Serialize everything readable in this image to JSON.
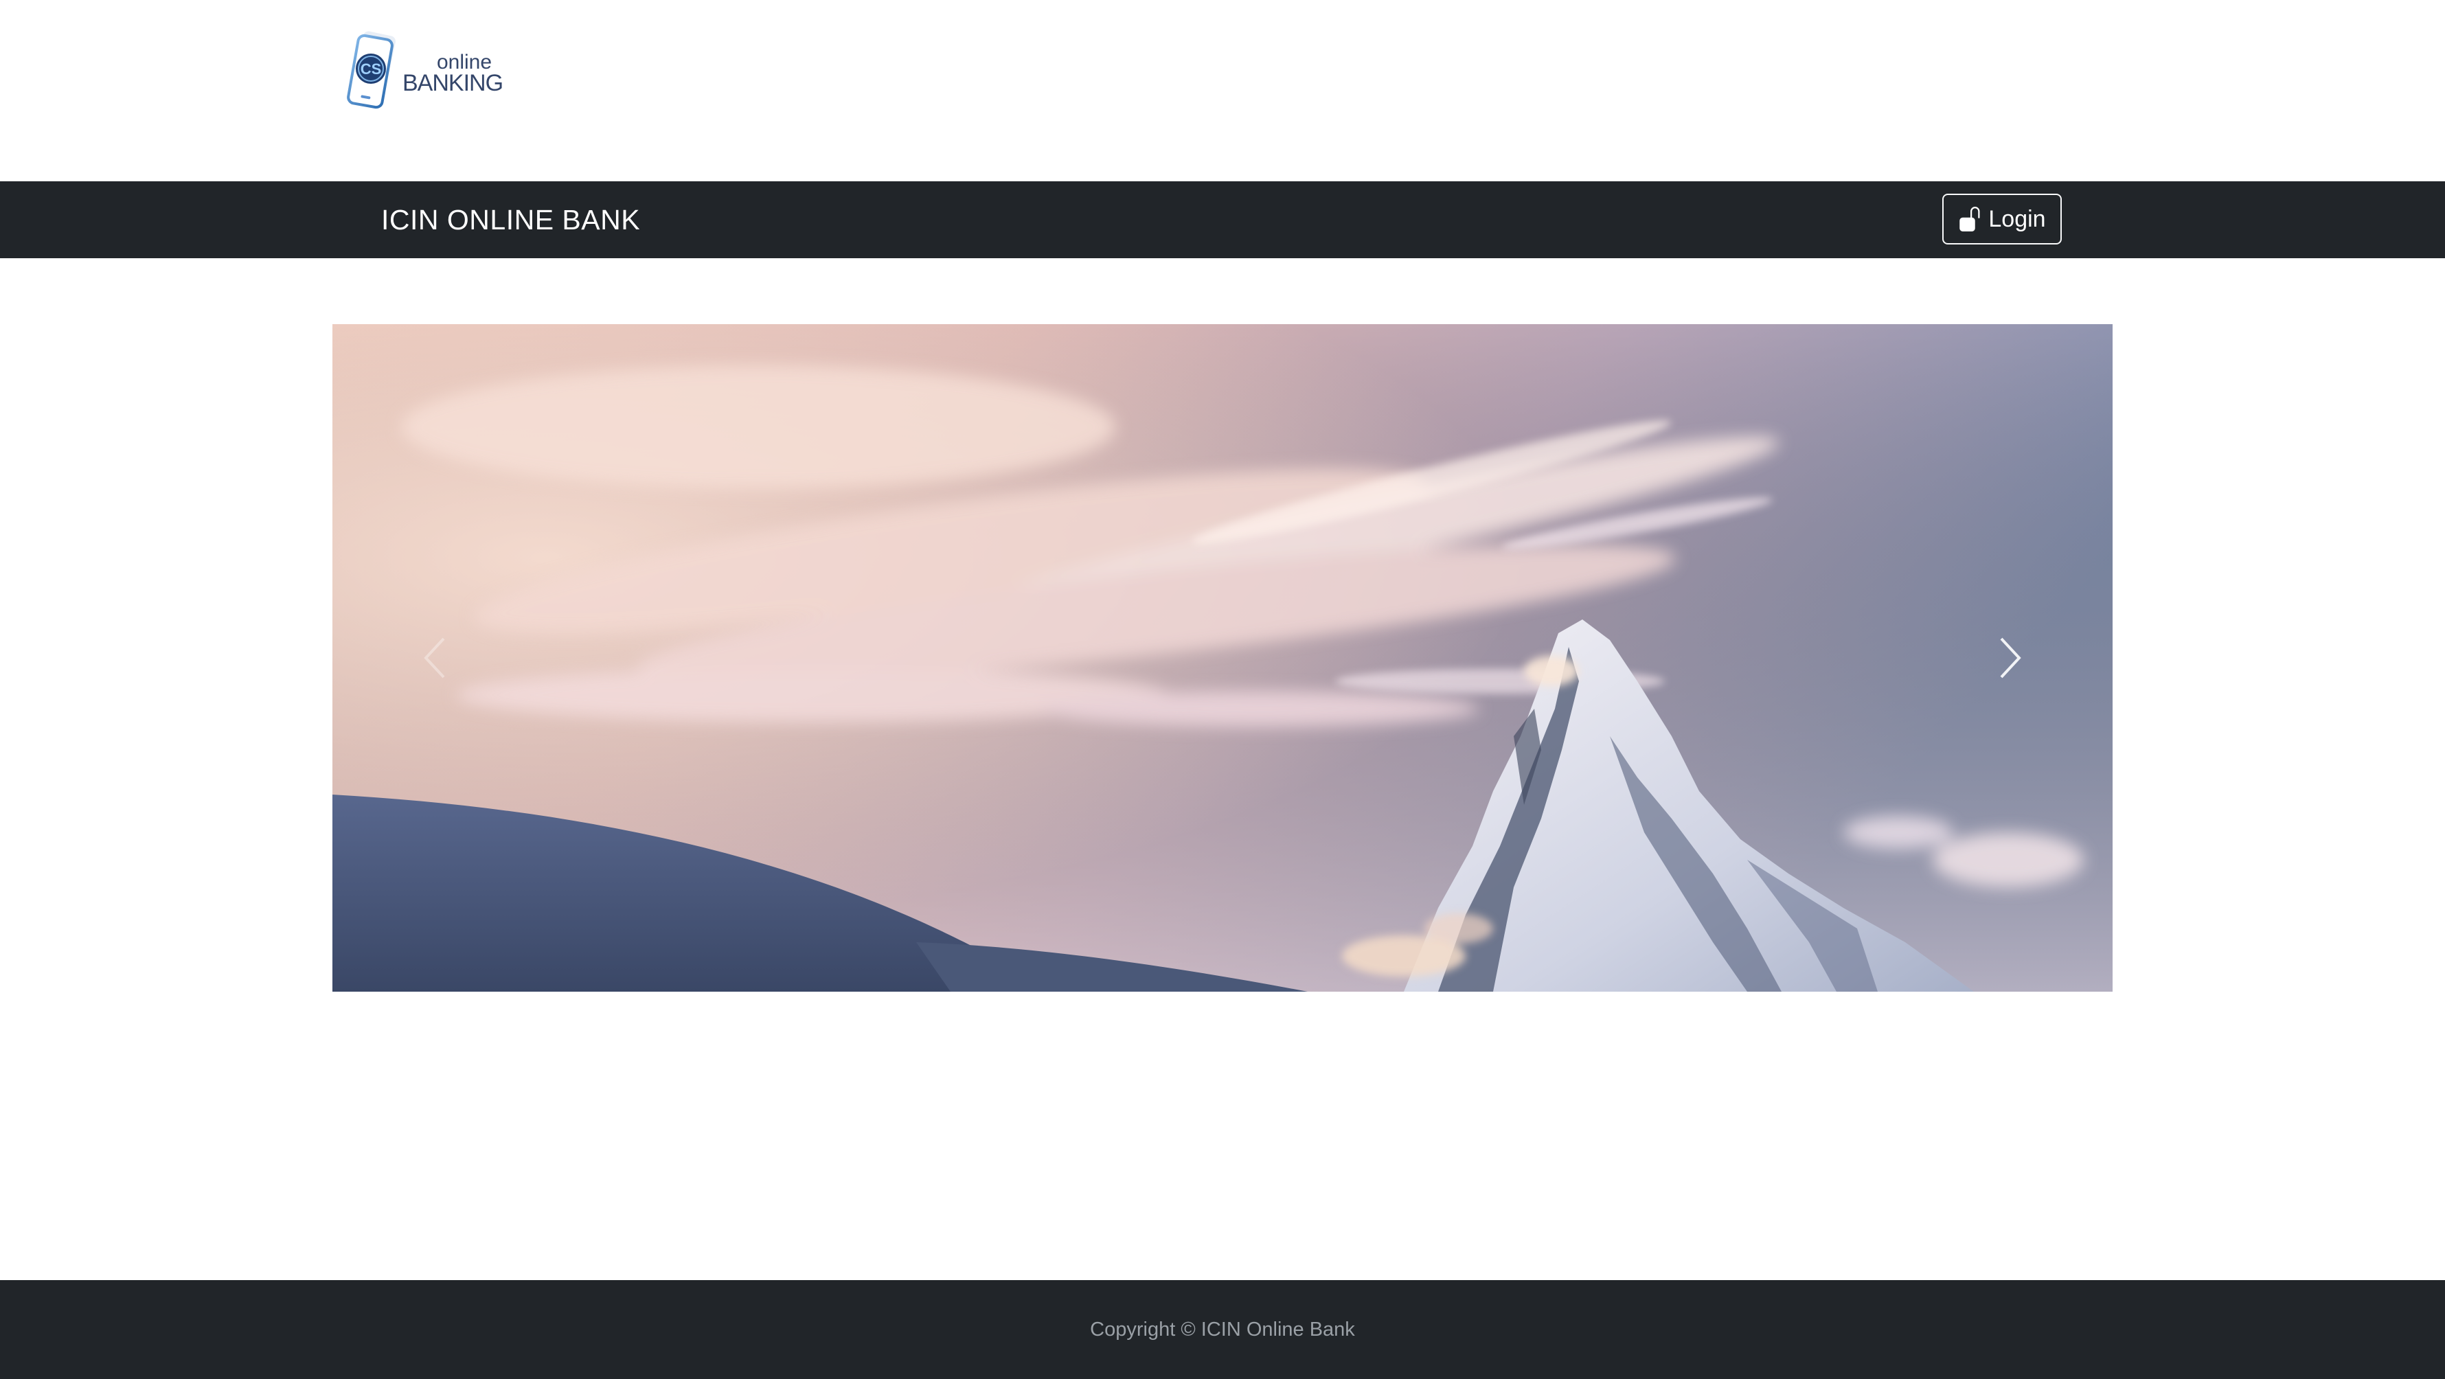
{
  "logo": {
    "badge_text": "CS",
    "line1": "online",
    "line2": "BANKING"
  },
  "navbar": {
    "brand": "ICIN ONLINE BANK",
    "login_label": "Login",
    "login_icon": "unlock-icon"
  },
  "carousel": {
    "slide_description": "mountain-peak-at-sunset",
    "prev_icon": "chevron-left-icon",
    "next_icon": "chevron-right-icon"
  },
  "footer": {
    "copyright": "Copyright © ICIN Online Bank"
  },
  "colors": {
    "navbar_bg": "#212529",
    "footer_bg": "#212529",
    "footer_text": "#9aa0a6",
    "logo_blue": "#34466a"
  }
}
